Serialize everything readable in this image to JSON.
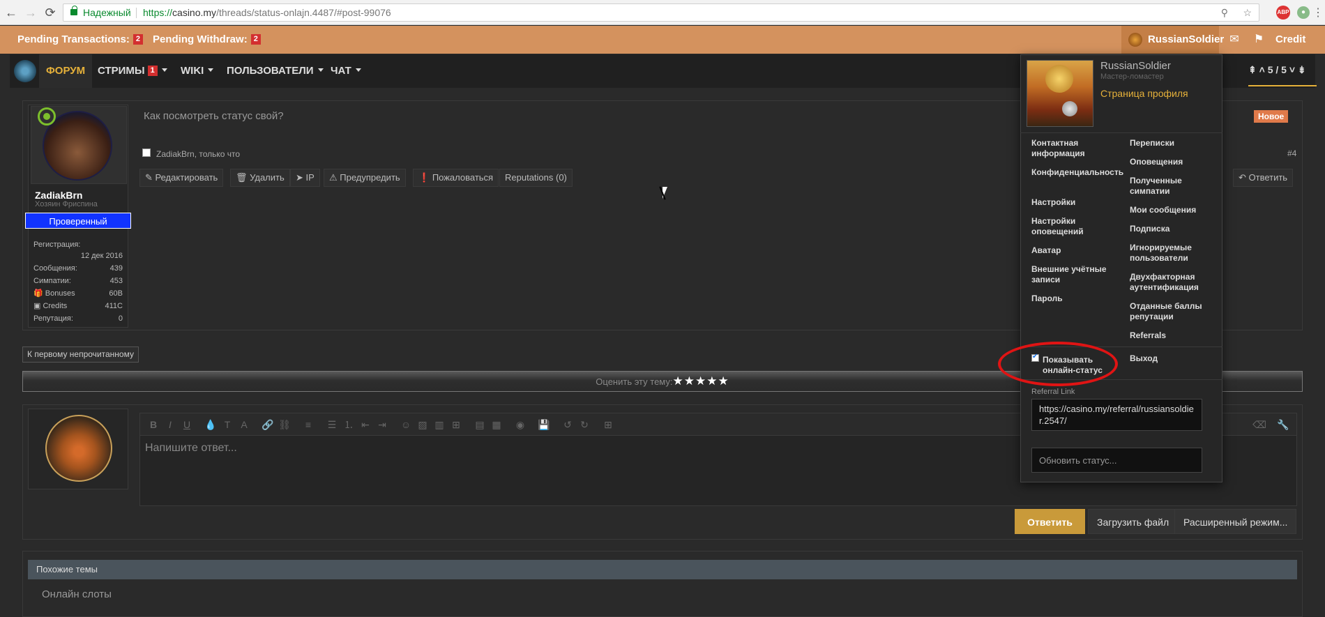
{
  "browser": {
    "secure_label": "Надежный",
    "url_scheme": "https://",
    "url_host": "casino.my",
    "url_path": "/threads/status-onlajn.4487/#post-99076"
  },
  "topbar": {
    "pending_transactions_label": "Pending Transactions:",
    "pending_transactions_count": "2",
    "pending_withdraw_label": "Pending Withdraw:",
    "pending_withdraw_count": "2",
    "username": "RussianSoldier",
    "credit_label": "Credit"
  },
  "nav": {
    "items": [
      {
        "label": "Форум"
      },
      {
        "label": "Стримы",
        "badge": "1"
      },
      {
        "label": "Wiki"
      },
      {
        "label": "Пользователи"
      },
      {
        "label": "Чат"
      }
    ],
    "pager": "5 / 5"
  },
  "post": {
    "status_question": "Как посмотреть статус свой?",
    "new_badge": "Новое",
    "meta": "ZadiakBrn, только что",
    "number": "#4",
    "poster": {
      "name": "ZadiakBrn",
      "title": "Хозяин Фриспина",
      "verified": "Проверенный",
      "stats": [
        {
          "label": "Регистрация:",
          "value": "12 дек 2016"
        },
        {
          "label": "Сообщения:",
          "value": "439"
        },
        {
          "label": "Симпатии:",
          "value": "453"
        },
        {
          "label": "Bonuses",
          "value": "60B"
        },
        {
          "label": "Credits",
          "value": "411C"
        },
        {
          "label": "Репутация:",
          "value": "0"
        }
      ]
    },
    "actions": {
      "edit": "Редактировать",
      "delete": "Удалить",
      "ip": "IP",
      "warn": "Предупредить",
      "report": "Пожаловаться",
      "reputations": "Reputations (0)",
      "reply": "Ответить"
    }
  },
  "first_unread": "К первому непрочитанному",
  "rating": {
    "label": "Оценить эту тему:",
    "stars": "★★★★★"
  },
  "reply_box": {
    "placeholder": "Напишите ответ...",
    "reply_button": "Ответить",
    "upload_button": "Загрузить файл",
    "advanced_button": "Расширенный режим..."
  },
  "similar": {
    "heading": "Похожие темы",
    "items": [
      "Онлайн слоты"
    ]
  },
  "dropdown": {
    "name": "RussianSoldier",
    "rank": "Мастер-ломастер",
    "profile_link": "Страница профиля",
    "left_links": [
      "Контактная информация",
      "Конфиденциальность",
      "Настройки",
      "Настройки оповещений",
      "Аватар",
      "Внешние учётные записи",
      "Пароль"
    ],
    "right_links": [
      "Переписки",
      "Оповещения",
      "Полученные симпатии",
      "Мои сообщения",
      "Подписка",
      "Игнорируемые пользователи",
      "Двухфакторная аутентификация",
      "Отданные баллы репутации",
      "Referrals"
    ],
    "show_online": "Показывать онлайн-статус",
    "show_online_checked": true,
    "logout": "Выход",
    "referral_label": "Referral Link",
    "referral_link": "https://casino.my/referral/russiansoldier.2547/",
    "status_placeholder": "Обновить статус..."
  },
  "colors": {
    "topbar": "#d4925e",
    "accent": "#e6b13a",
    "verified": "#1133ff",
    "annotation": "#e01414"
  }
}
